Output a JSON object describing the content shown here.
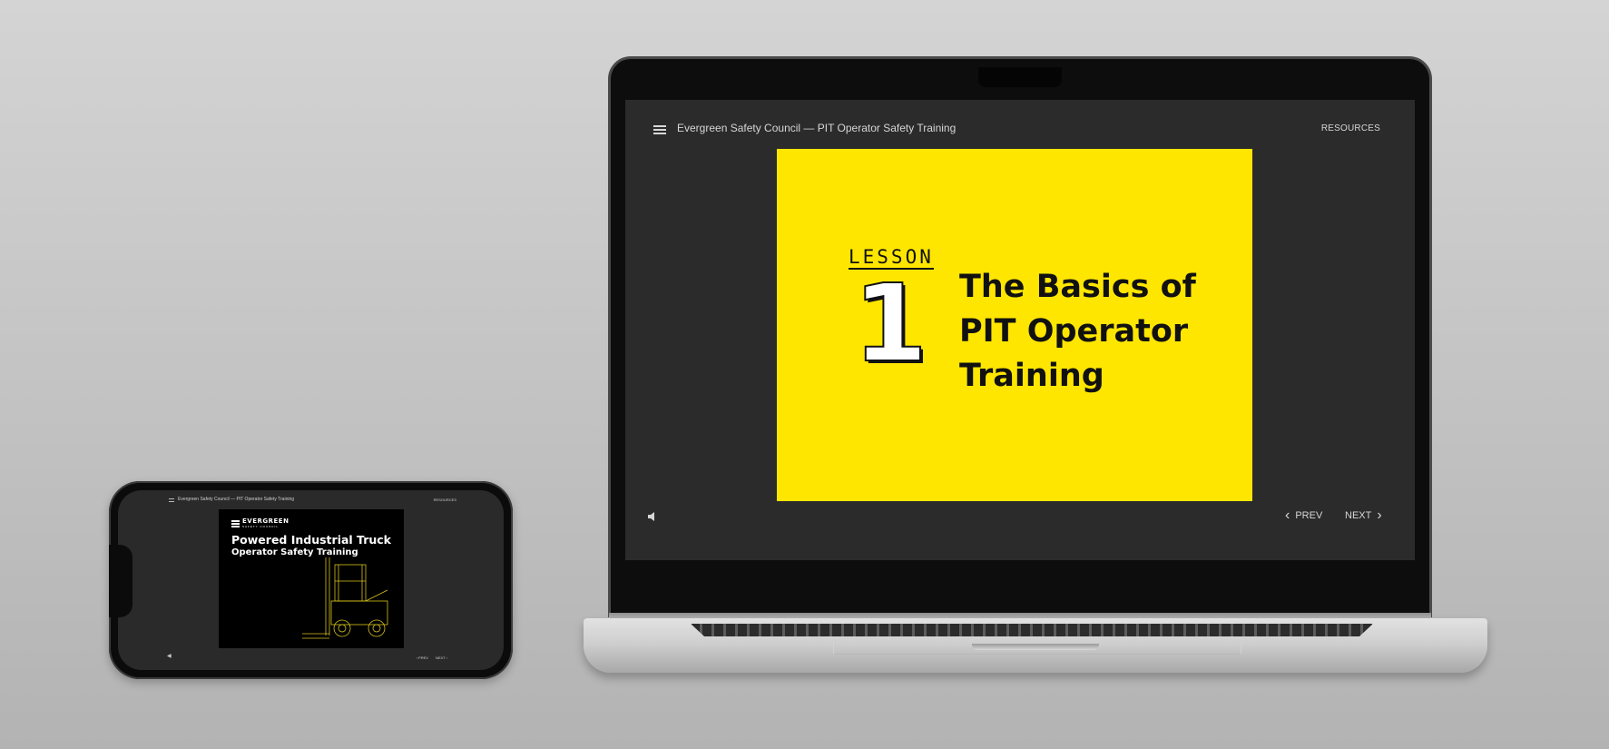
{
  "header": {
    "course_title": "Evergreen Safety Council — PIT Operator Safety Training",
    "resources_label": "RESOURCES"
  },
  "lesson_slide": {
    "lesson_label": "LESSON",
    "lesson_number": "1",
    "title_line1": "The Basics of",
    "title_line2": "PIT Operator",
    "title_line3": "Training",
    "background_color": "#ffe600"
  },
  "footer": {
    "prev_label": "PREV",
    "next_label": "NEXT"
  },
  "phone": {
    "course_title": "Evergreen Safety Council — PIT Operator Safety Training",
    "resources_label": "RESOURCES",
    "logo_name": "EVERGREEN",
    "logo_sub": "SAFETY COUNCIL",
    "heading": "Powered Industrial Truck",
    "subheading": "Operator Safety Training",
    "prev_label": "PREV",
    "next_label": "NEXT"
  },
  "icons": {
    "menu": "hamburger-menu-icon",
    "sound": "speaker-icon",
    "prev": "chevron-left-icon",
    "next": "chevron-right-icon",
    "forklift": "forklift-wireframe-icon"
  }
}
